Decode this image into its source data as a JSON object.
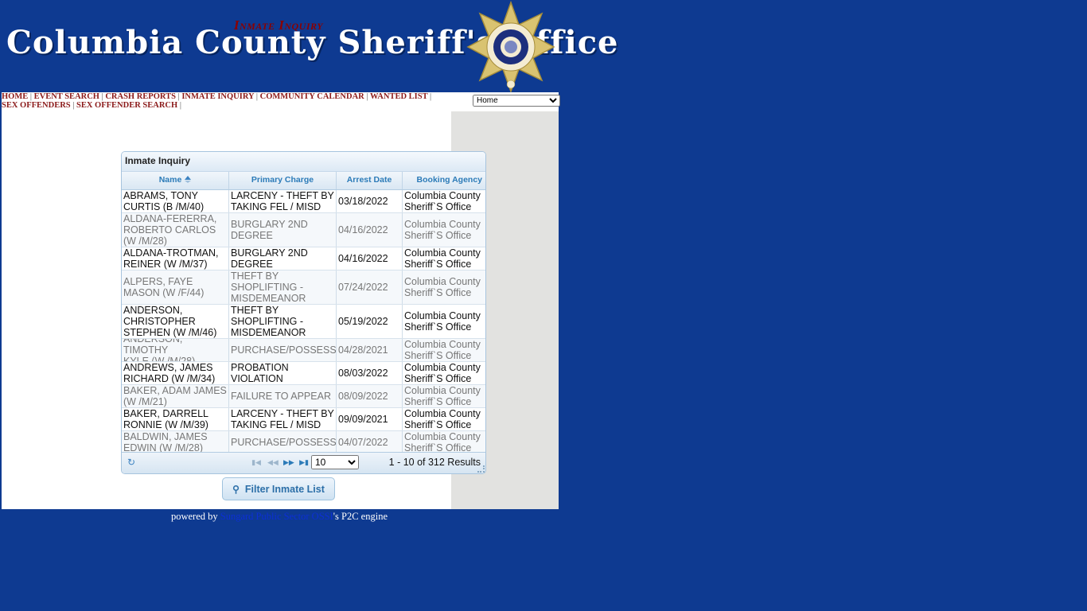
{
  "header": {
    "site_title": "Columbia County Sheriff's Office"
  },
  "nav": {
    "links": [
      "HOME",
      "EVENT SEARCH",
      "CRASH REPORTS",
      "INMATE INQUIRY",
      "COMMUNITY CALENDAR",
      "WANTED LIST",
      "SEX OFFENDERS",
      "SEX OFFENDER SEARCH"
    ],
    "select_value": "Home"
  },
  "page": {
    "title": "Inmate Inquiry"
  },
  "grid": {
    "caption": "Inmate Inquiry",
    "columns": [
      "Name",
      "Primary Charge",
      "Arrest Date",
      "Booking Agency"
    ],
    "rows": [
      [
        "ABRAMS, TONY\nCURTIS (B /M/40)",
        "LARCENY - THEFT BY\nTAKING FEL / MISD",
        "03/18/2022",
        "Columbia County\nSheriff`S Office"
      ],
      [
        "ALDANA-FERERRA,\nROBERTO CARLOS\n(W /M/28)",
        "BURGLARY 2ND\nDEGREE",
        "04/16/2022",
        "Columbia County\nSheriff`S Office"
      ],
      [
        "ALDANA-TROTMAN,\nREINER (W /M/37)",
        "BURGLARY 2ND\nDEGREE",
        "04/16/2022",
        "Columbia County\nSheriff`S Office"
      ],
      [
        "ALPERS, FAYE\nMASON (W /F/44)",
        "THEFT BY\nSHOPLIFTING -\nMISDEMEANOR",
        "07/24/2022",
        "Columbia County\nSheriff`S Office"
      ],
      [
        "ANDERSON,\nCHRISTOPHER\nSTEPHEN (W /M/46)",
        "THEFT BY\nSHOPLIFTING -\nMISDEMEANOR",
        "05/19/2022",
        "Columbia County\nSheriff`S Office"
      ],
      [
        "ANDERSON, TIMOTHY\nKYLE (W /M/28)",
        "PURCHASE/POSSESSI",
        "04/28/2021",
        "Columbia County\nSheriff`S Office"
      ],
      [
        "ANDREWS, JAMES\nRICHARD (W /M/34)",
        "PROBATION\nVIOLATION",
        "08/03/2022",
        "Columbia County\nSheriff`S Office"
      ],
      [
        "BAKER, ADAM JAMES\n(W /M/21)",
        "FAILURE TO APPEAR",
        "08/09/2022",
        "Columbia County\nSheriff`S Office"
      ],
      [
        "BAKER, DARRELL\nRONNIE (W /M/39)",
        "LARCENY - THEFT BY\nTAKING FEL / MISD",
        "09/09/2021",
        "Columbia County\nSheriff`S Office"
      ],
      [
        "BALDWIN, JAMES\nEDWIN (W /M/28)",
        "PURCHASE/POSSESSI",
        "04/07/2022",
        "Columbia County\nSheriff`S Office"
      ]
    ],
    "page_size": "10",
    "results_text": "1 - 10 of 312 Results"
  },
  "filter_button": "Filter Inmate List",
  "footer": {
    "prefix": "powered by ",
    "link": "Sungard Public Sector OSSI",
    "suffix": "'s P2C engine"
  },
  "colors": {
    "background": "#0e3a91",
    "nav_link": "#8b1a1a",
    "title": "#8b0000",
    "grid_header_text": "#2c7bb8"
  },
  "icons": [
    "sheriff-badge-icon",
    "sort-asc-icon",
    "refresh-icon",
    "first-page-icon",
    "prev-page-icon",
    "next-page-icon",
    "last-page-icon",
    "search-icon",
    "resize-grip-icon"
  ]
}
